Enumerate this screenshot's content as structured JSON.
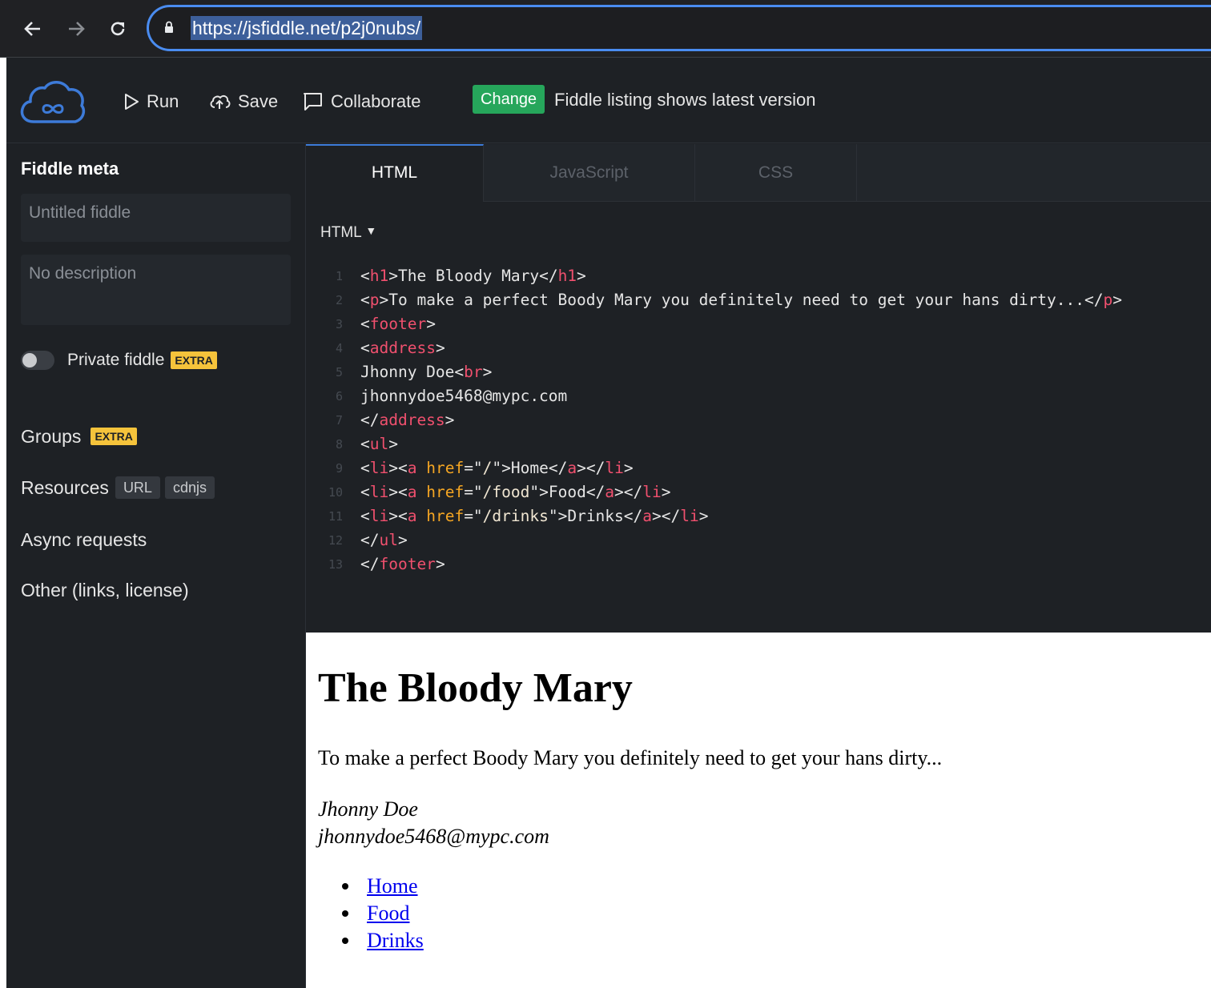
{
  "browser": {
    "url": "https://jsfiddle.net/p2j0nubs/",
    "back_icon": "arrow-left-icon",
    "forward_icon": "arrow-right-icon",
    "reload_icon": "reload-icon",
    "lock_icon": "lock-icon"
  },
  "toolbar": {
    "run_label": "Run",
    "save_label": "Save",
    "collaborate_label": "Collaborate",
    "change_badge": "Change",
    "change_text": "Fiddle listing shows latest version"
  },
  "sidebar": {
    "heading": "Fiddle meta",
    "title_placeholder": "Untitled fiddle",
    "description_placeholder": "No description",
    "private_label": "Private fiddle",
    "extra_badge": "EXTRA",
    "groups_label": "Groups",
    "resources_label": "Resources",
    "resources_tags": [
      "URL",
      "cdnjs"
    ],
    "async_label": "Async requests",
    "other_label": "Other (links, license)"
  },
  "editor": {
    "tabs": [
      "HTML",
      "JavaScript",
      "CSS"
    ],
    "active_tab": "HTML",
    "panel_label": "HTML",
    "panel_arrow": "▼",
    "lines": [
      [
        {
          "t": "punc",
          "v": "<"
        },
        {
          "t": "tag",
          "v": "h1"
        },
        {
          "t": "punc",
          "v": ">The Bloody Mary</"
        },
        {
          "t": "tag",
          "v": "h1"
        },
        {
          "t": "punc",
          "v": ">"
        }
      ],
      [
        {
          "t": "punc",
          "v": "<"
        },
        {
          "t": "tag",
          "v": "p"
        },
        {
          "t": "punc",
          "v": ">To make a perfect Boody Mary you definitely need to get your hans dirty...</"
        },
        {
          "t": "tag",
          "v": "p"
        },
        {
          "t": "punc",
          "v": ">"
        }
      ],
      [
        {
          "t": "punc",
          "v": "<"
        },
        {
          "t": "tag",
          "v": "footer"
        },
        {
          "t": "punc",
          "v": ">"
        }
      ],
      [
        {
          "t": "punc",
          "v": "<"
        },
        {
          "t": "tag",
          "v": "address"
        },
        {
          "t": "punc",
          "v": ">"
        }
      ],
      [
        {
          "t": "punc",
          "v": "Jhonny Doe<"
        },
        {
          "t": "tag",
          "v": "br"
        },
        {
          "t": "punc",
          "v": ">"
        }
      ],
      [
        {
          "t": "punc",
          "v": "jhonnydoe5468@mypc.com"
        }
      ],
      [
        {
          "t": "punc",
          "v": "</"
        },
        {
          "t": "tag",
          "v": "address"
        },
        {
          "t": "punc",
          "v": ">"
        }
      ],
      [
        {
          "t": "punc",
          "v": "<"
        },
        {
          "t": "tag",
          "v": "ul"
        },
        {
          "t": "punc",
          "v": ">"
        }
      ],
      [
        {
          "t": "punc",
          "v": "<"
        },
        {
          "t": "tag",
          "v": "li"
        },
        {
          "t": "punc",
          "v": "><"
        },
        {
          "t": "tag",
          "v": "a"
        },
        {
          "t": "punc",
          "v": " "
        },
        {
          "t": "attr",
          "v": "href"
        },
        {
          "t": "punc",
          "v": "=\""
        },
        {
          "t": "str",
          "v": "/"
        },
        {
          "t": "punc",
          "v": "\">Home</"
        },
        {
          "t": "tag",
          "v": "a"
        },
        {
          "t": "punc",
          "v": "></"
        },
        {
          "t": "tag",
          "v": "li"
        },
        {
          "t": "punc",
          "v": ">"
        }
      ],
      [
        {
          "t": "punc",
          "v": "<"
        },
        {
          "t": "tag",
          "v": "li"
        },
        {
          "t": "punc",
          "v": "><"
        },
        {
          "t": "tag",
          "v": "a"
        },
        {
          "t": "punc",
          "v": " "
        },
        {
          "t": "attr",
          "v": "href"
        },
        {
          "t": "punc",
          "v": "=\""
        },
        {
          "t": "str",
          "v": "/food"
        },
        {
          "t": "punc",
          "v": "\">Food</"
        },
        {
          "t": "tag",
          "v": "a"
        },
        {
          "t": "punc",
          "v": "></"
        },
        {
          "t": "tag",
          "v": "li"
        },
        {
          "t": "punc",
          "v": ">"
        }
      ],
      [
        {
          "t": "punc",
          "v": "<"
        },
        {
          "t": "tag",
          "v": "li"
        },
        {
          "t": "punc",
          "v": "><"
        },
        {
          "t": "tag",
          "v": "a"
        },
        {
          "t": "punc",
          "v": " "
        },
        {
          "t": "attr",
          "v": "href"
        },
        {
          "t": "punc",
          "v": "=\""
        },
        {
          "t": "str",
          "v": "/drinks"
        },
        {
          "t": "punc",
          "v": "\">Drinks</"
        },
        {
          "t": "tag",
          "v": "a"
        },
        {
          "t": "punc",
          "v": "></"
        },
        {
          "t": "tag",
          "v": "li"
        },
        {
          "t": "punc",
          "v": ">"
        }
      ],
      [
        {
          "t": "punc",
          "v": "</"
        },
        {
          "t": "tag",
          "v": "ul"
        },
        {
          "t": "punc",
          "v": ">"
        }
      ],
      [
        {
          "t": "punc",
          "v": "</"
        },
        {
          "t": "tag",
          "v": "footer"
        },
        {
          "t": "punc",
          "v": ">"
        }
      ]
    ]
  },
  "result": {
    "heading": "The Bloody Mary",
    "paragraph": "To make a perfect Boody Mary you definitely need to get your hans dirty...",
    "address_name": "Jhonny Doe",
    "address_email": "jhonnydoe5468@mypc.com",
    "links": [
      "Home",
      "Food",
      "Drinks"
    ]
  },
  "colors": {
    "accent": "#3d7bd9",
    "change_badge": "#26a65b",
    "extra_badge": "#f5c33b",
    "syntax_tag": "#f0506e",
    "syntax_attr": "#f5a623",
    "link": "#0000ee"
  }
}
